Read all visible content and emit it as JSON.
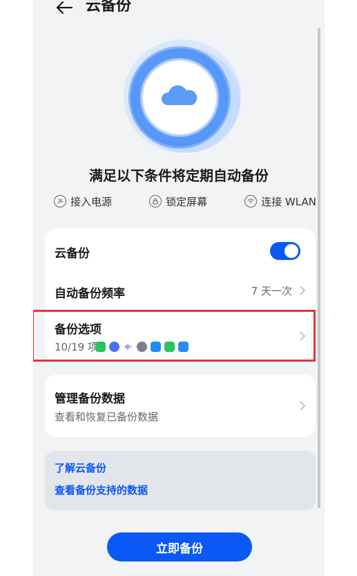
{
  "header": {
    "title": "云备份"
  },
  "hero": {
    "subtitle": "满足以下条件将定期自动备份"
  },
  "conditions": [
    {
      "label": "接入电源",
      "icon": "power-plug-icon"
    },
    {
      "label": "锁定屏幕",
      "icon": "lock-icon"
    },
    {
      "label": "连接 WLAN",
      "icon": "wifi-icon"
    }
  ],
  "settings": {
    "cloud_backup": {
      "label": "云备份",
      "enabled": true
    },
    "frequency": {
      "label": "自动备份频率",
      "value": "7 天一次"
    },
    "options": {
      "label": "备份选项",
      "summary": "10/19 项",
      "apps": [
        "messages-icon",
        "music-icon",
        "voice-recorder-icon",
        "gallery-icon",
        "chat-icon",
        "phone-icon",
        "contacts-icon"
      ]
    }
  },
  "manage": {
    "label": "管理备份数据",
    "sub": "查看和恢复已备份数据"
  },
  "links": {
    "learn": "了解云备份",
    "supported": "查看备份支持的数据"
  },
  "backup_button": "立即备份",
  "colors": {
    "accent": "#0a59f7",
    "highlight": "#e8333a",
    "background": "#f1f3f5"
  }
}
